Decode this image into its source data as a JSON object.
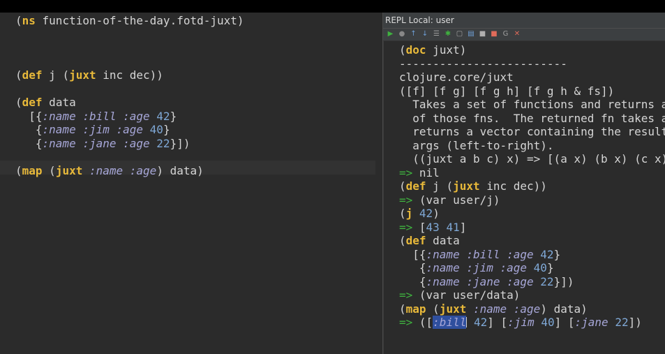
{
  "editor": {
    "lines": [
      [
        {
          "t": "(",
          "c": ""
        },
        {
          "t": "ns",
          "c": "kw"
        },
        {
          "t": " function-of-the-day.fotd-juxt)",
          "c": ""
        }
      ],
      [],
      [],
      [],
      [
        {
          "t": "(",
          "c": ""
        },
        {
          "t": "def",
          "c": "kw"
        },
        {
          "t": " j (",
          "c": ""
        },
        {
          "t": "juxt",
          "c": "kw"
        },
        {
          "t": " inc dec))",
          "c": ""
        }
      ],
      [],
      [
        {
          "t": "(",
          "c": ""
        },
        {
          "t": "def",
          "c": "kw"
        },
        {
          "t": " data",
          "c": ""
        }
      ],
      [
        {
          "t": "  [{",
          "c": ""
        },
        {
          "t": ":name :bill :age",
          "c": "kwd"
        },
        {
          "t": " ",
          "c": ""
        },
        {
          "t": "42",
          "c": "num"
        },
        {
          "t": "}",
          "c": ""
        }
      ],
      [
        {
          "t": "   {",
          "c": ""
        },
        {
          "t": ":name :jim :age",
          "c": "kwd"
        },
        {
          "t": " ",
          "c": ""
        },
        {
          "t": "40",
          "c": "num"
        },
        {
          "t": "}",
          "c": ""
        }
      ],
      [
        {
          "t": "   {",
          "c": ""
        },
        {
          "t": ":name :jane :age",
          "c": "kwd"
        },
        {
          "t": " ",
          "c": ""
        },
        {
          "t": "22",
          "c": "num"
        },
        {
          "t": "}])",
          "c": ""
        }
      ],
      [],
      [
        {
          "t": "(",
          "c": ""
        },
        {
          "t": "map",
          "c": "kw"
        },
        {
          "t": " (",
          "c": ""
        },
        {
          "t": "juxt",
          "c": "kw"
        },
        {
          "t": " ",
          "c": ""
        },
        {
          "t": ":name :age",
          "c": "kwd"
        },
        {
          "t": ") data)",
          "c": ""
        }
      ]
    ]
  },
  "repl": {
    "title": "REPL Local: user",
    "toolbar": [
      {
        "name": "run-icon",
        "glyph": "▶",
        "color": "#3fb13f"
      },
      {
        "name": "stop-icon",
        "glyph": "●",
        "color": "#888888"
      },
      {
        "name": "history-up-icon",
        "glyph": "↑",
        "color": "#6fa0d8"
      },
      {
        "name": "history-down-icon",
        "glyph": "↓",
        "color": "#6fa0d8"
      },
      {
        "name": "load-file-icon",
        "glyph": "☰",
        "color": "#a0a0a0"
      },
      {
        "name": "sync-ns-icon",
        "glyph": "✱",
        "color": "#3fb13f"
      },
      {
        "name": "copy-icon",
        "glyph": "▢",
        "color": "#a0a0a0"
      },
      {
        "name": "clear-icon",
        "glyph": "▤",
        "color": "#6fa0d8"
      },
      {
        "name": "toggle-output-icon",
        "glyph": "■",
        "color": "#b0b0b0"
      },
      {
        "name": "terminate-icon",
        "glyph": "■",
        "color": "#e06b5a"
      },
      {
        "name": "settings-icon",
        "glyph": "G",
        "color": "#a0a0a0"
      },
      {
        "name": "close-icon",
        "glyph": "✕",
        "color": "#e06b5a"
      }
    ],
    "lines": [
      [
        {
          "t": "(",
          "c": ""
        },
        {
          "t": "doc",
          "c": "kw"
        },
        {
          "t": " juxt)",
          "c": ""
        }
      ],
      [
        {
          "t": "-------------------------",
          "c": ""
        }
      ],
      [
        {
          "t": "clojure.core/juxt",
          "c": ""
        }
      ],
      [
        {
          "t": "([f] [f g] [f g h] [f g h & fs])",
          "c": ""
        }
      ],
      [
        {
          "t": "  Takes a set of functions and returns a f",
          "c": ""
        }
      ],
      [
        {
          "t": "  of those fns.  The returned fn takes a v",
          "c": ""
        }
      ],
      [
        {
          "t": "  returns a vector containing the result o",
          "c": ""
        }
      ],
      [
        {
          "t": "  args (left-to-right).",
          "c": ""
        }
      ],
      [
        {
          "t": "  ((juxt a b c) x) => [(a x) (b x) (c x)]",
          "c": ""
        }
      ],
      [
        {
          "t": "=>",
          "c": "arrow"
        },
        {
          "t": " nil",
          "c": ""
        }
      ],
      [
        {
          "t": "(",
          "c": ""
        },
        {
          "t": "def",
          "c": "kw"
        },
        {
          "t": " j (",
          "c": ""
        },
        {
          "t": "juxt",
          "c": "kw"
        },
        {
          "t": " inc dec))",
          "c": ""
        }
      ],
      [
        {
          "t": "=>",
          "c": "arrow"
        },
        {
          "t": " (var user/j)",
          "c": ""
        }
      ],
      [
        {
          "t": "(",
          "c": ""
        },
        {
          "t": "j",
          "c": "kw"
        },
        {
          "t": " ",
          "c": ""
        },
        {
          "t": "42",
          "c": "num"
        },
        {
          "t": ")",
          "c": ""
        }
      ],
      [
        {
          "t": "=>",
          "c": "arrow"
        },
        {
          "t": " [",
          "c": ""
        },
        {
          "t": "43",
          "c": "num"
        },
        {
          "t": " ",
          "c": ""
        },
        {
          "t": "41",
          "c": "num"
        },
        {
          "t": "]",
          "c": ""
        }
      ],
      [
        {
          "t": "(",
          "c": ""
        },
        {
          "t": "def",
          "c": "kw"
        },
        {
          "t": " data",
          "c": ""
        }
      ],
      [
        {
          "t": "  [{",
          "c": ""
        },
        {
          "t": ":name :bill :age",
          "c": "kwd"
        },
        {
          "t": " ",
          "c": ""
        },
        {
          "t": "42",
          "c": "num"
        },
        {
          "t": "}",
          "c": ""
        }
      ],
      [
        {
          "t": "   {",
          "c": ""
        },
        {
          "t": ":name :jim :age",
          "c": "kwd"
        },
        {
          "t": " ",
          "c": ""
        },
        {
          "t": "40",
          "c": "num"
        },
        {
          "t": "}",
          "c": ""
        }
      ],
      [
        {
          "t": "   {",
          "c": ""
        },
        {
          "t": ":name :jane :age",
          "c": "kwd"
        },
        {
          "t": " ",
          "c": ""
        },
        {
          "t": "22",
          "c": "num"
        },
        {
          "t": "}])",
          "c": ""
        }
      ],
      [
        {
          "t": "=>",
          "c": "arrow"
        },
        {
          "t": " (var user/data)",
          "c": ""
        }
      ],
      [
        {
          "t": "(",
          "c": ""
        },
        {
          "t": "map",
          "c": "kw"
        },
        {
          "t": " (",
          "c": ""
        },
        {
          "t": "juxt",
          "c": "kw"
        },
        {
          "t": " ",
          "c": ""
        },
        {
          "t": ":name :age",
          "c": "kwd"
        },
        {
          "t": ") data)",
          "c": ""
        }
      ],
      [
        {
          "t": "=>",
          "c": "arrow"
        },
        {
          "t": " ([",
          "c": ""
        },
        {
          "t": ":bill",
          "c": "kwd sel"
        },
        {
          "t": "",
          "c": "caret"
        },
        {
          "t": " ",
          "c": ""
        },
        {
          "t": "42",
          "c": "num"
        },
        {
          "t": "] [",
          "c": ""
        },
        {
          "t": ":jim",
          "c": "kwd"
        },
        {
          "t": " ",
          "c": ""
        },
        {
          "t": "40",
          "c": "num"
        },
        {
          "t": "] [",
          "c": ""
        },
        {
          "t": ":jane",
          "c": "kwd"
        },
        {
          "t": " ",
          "c": ""
        },
        {
          "t": "22",
          "c": "num"
        },
        {
          "t": "])",
          "c": ""
        }
      ]
    ]
  }
}
